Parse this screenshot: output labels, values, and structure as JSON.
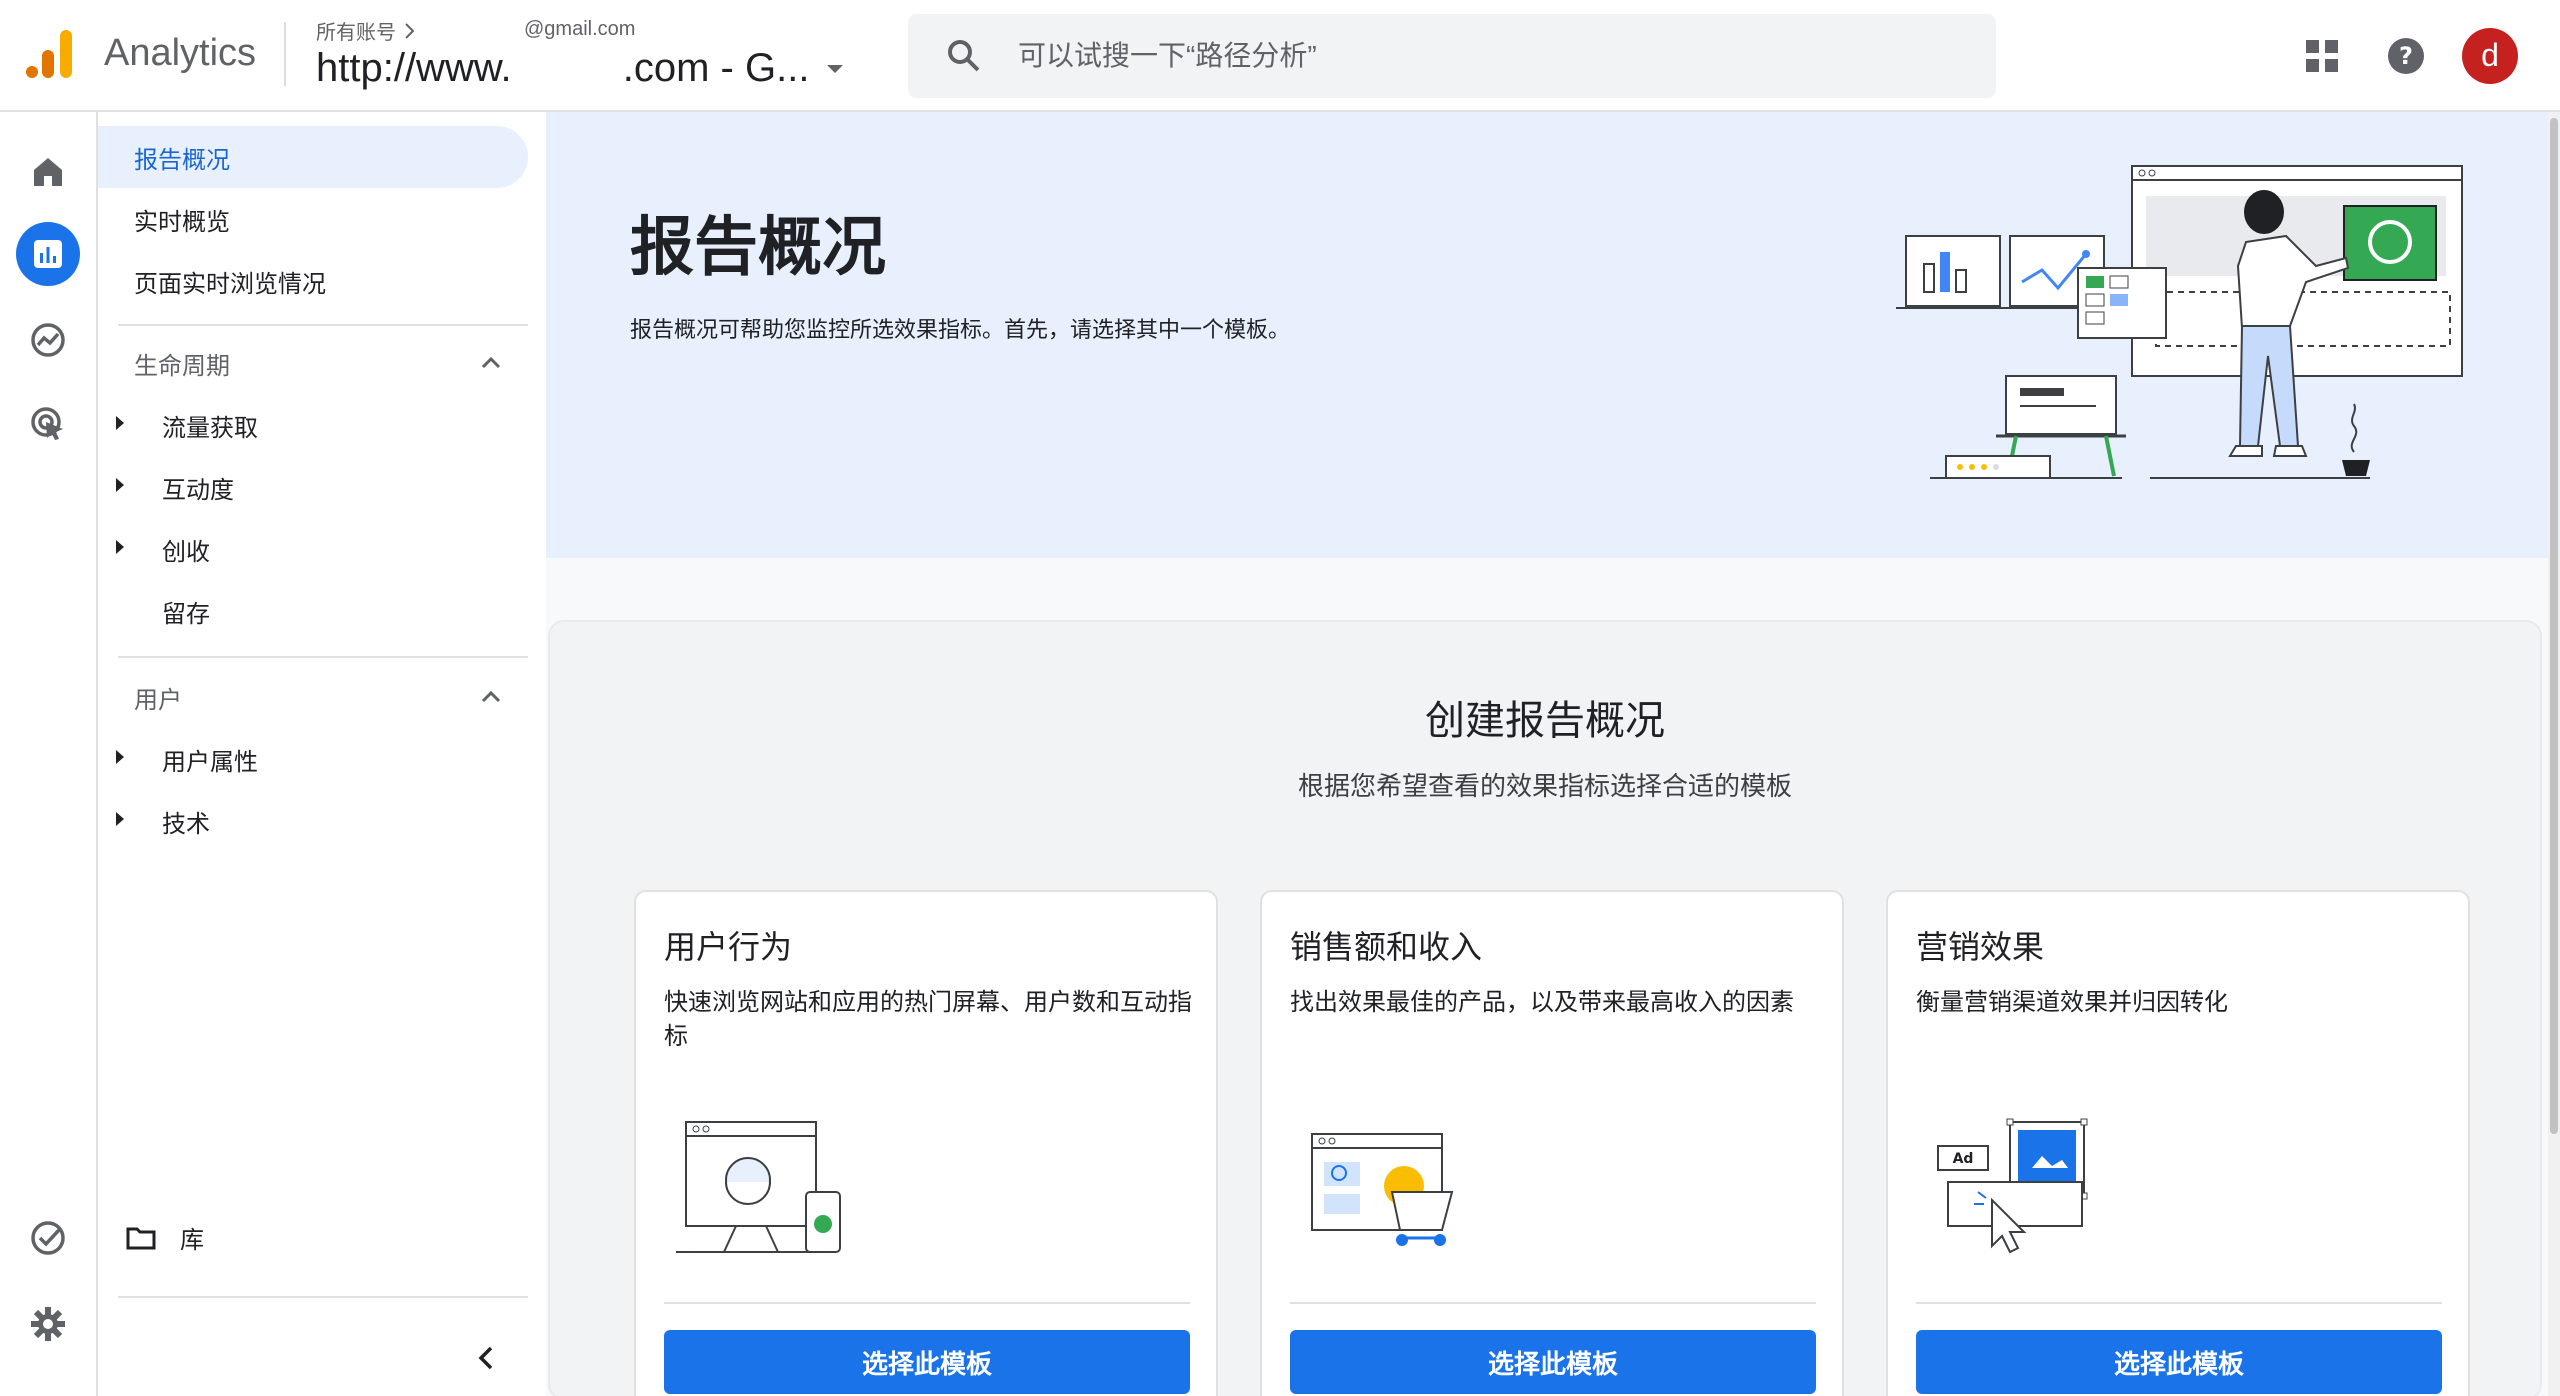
{
  "header": {
    "app_name": "Analytics",
    "account_crumb": "所有账号",
    "account_email": "@gmail.com",
    "property_name": "http://www.          .com - G...",
    "search_placeholder": "可以试搜一下“路径分析”",
    "avatar_letter": "d"
  },
  "sidenav": {
    "items": [
      {
        "label": "报告概况"
      },
      {
        "label": "实时概览"
      },
      {
        "label": "页面实时浏览情况"
      }
    ],
    "sections": [
      {
        "title": "生命周期",
        "children": [
          {
            "label": "流量获取"
          },
          {
            "label": "互动度"
          },
          {
            "label": "创收"
          },
          {
            "label": "留存"
          }
        ]
      },
      {
        "title": "用户",
        "children": [
          {
            "label": "用户属性"
          },
          {
            "label": "技术"
          }
        ]
      }
    ],
    "library_label": "库"
  },
  "hero": {
    "title": "报告概况",
    "description": "报告概况可帮助您监控所选效果指标。首先，请选择其中一个模板。"
  },
  "create": {
    "title": "创建报告概况",
    "subtitle": "根据您希望查看的效果指标选择合适的模板",
    "cards": [
      {
        "title": "用户行为",
        "description": "快速浏览网站和应用的热门屏幕、用户数和互动指标",
        "button": "选择此模板"
      },
      {
        "title": "销售额和收入",
        "description": "找出效果最佳的产品，以及带来最高收入的因素",
        "button": "选择此模板"
      },
      {
        "title": "营销效果",
        "description": "衡量营销渠道效果并归因转化",
        "button": "选择此模板"
      }
    ]
  },
  "colors": {
    "accent": "#1a73e8",
    "hero_bg": "#e8f0fe",
    "avatar": "#c5221f"
  }
}
